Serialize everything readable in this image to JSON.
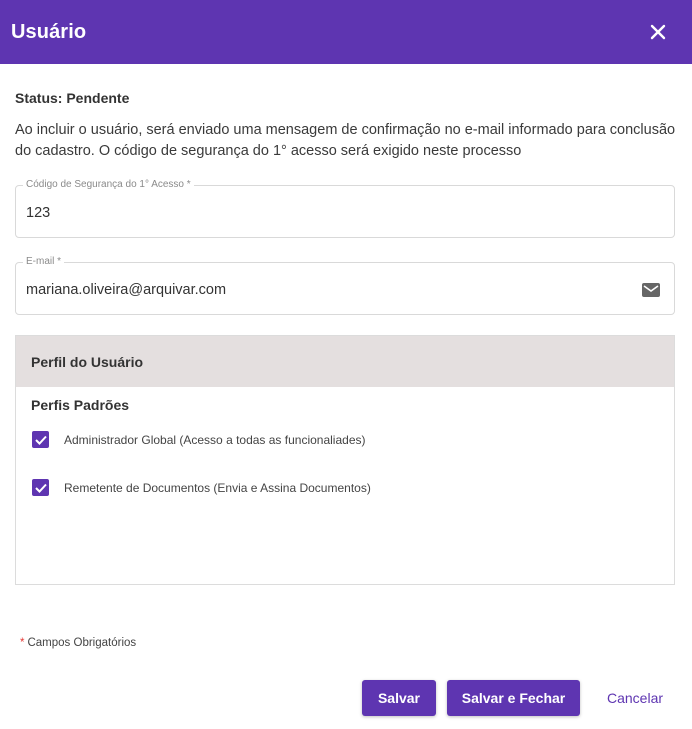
{
  "header": {
    "title": "Usuário",
    "close_icon": "close-icon"
  },
  "status": {
    "text": "Status: Pendente"
  },
  "info": {
    "text": "Ao incluir o usuário, será enviado uma mensagem de confirmação no e-mail informado para conclusão do cadastro. O código de segurança do 1° acesso será exigido neste processo"
  },
  "fields": {
    "codigo": {
      "label": "Código de Segurança do 1° Acesso *",
      "value": "123"
    },
    "email": {
      "label": "E-mail *",
      "value": "mariana.oliveira@arquivar.com",
      "icon": "mail-icon"
    }
  },
  "perfil": {
    "header": "Perfil do Usuário",
    "subtitle": "Perfis Padrões",
    "options": [
      {
        "label": "Administrador Global (Acesso a todas as funcionaliades)",
        "checked": true
      },
      {
        "label": "Remetente de Documentos (Envia e Assina Documentos)",
        "checked": true
      }
    ]
  },
  "required_note": {
    "star": "*",
    "text": "Campos Obrigatórios"
  },
  "actions": {
    "save": "Salvar",
    "save_close": "Salvar e Fechar",
    "cancel": "Cancelar"
  },
  "colors": {
    "primary": "#5e35b1",
    "panel_header": "#e4dfdf",
    "required_star": "#e53935"
  }
}
